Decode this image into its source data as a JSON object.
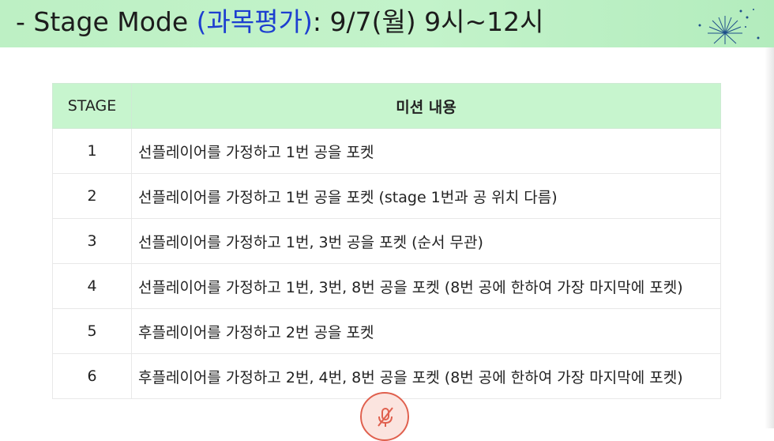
{
  "slide": {
    "title_prefix": "- Stage Mode ",
    "title_accent": "(과목평가)",
    "title_suffix": ": 9/7(월) 9시~12시"
  },
  "colors": {
    "header_band": "#c3f3ca",
    "title_accent": "#1d3fd0",
    "table_header": "#c7f5ce",
    "record_button": "#e0604e"
  },
  "table": {
    "headers": [
      "STAGE",
      "미션 내용"
    ],
    "rows": [
      {
        "stage": "1",
        "mission": "선플레이어를 가정하고 1번 공을 포켓"
      },
      {
        "stage": "2",
        "mission": "선플레이어를 가정하고 1번 공을 포켓 (stage 1번과 공 위치 다름)"
      },
      {
        "stage": "3",
        "mission": "선플레이어를 가정하고 1번, 3번 공을 포켓 (순서 무관)"
      },
      {
        "stage": "4",
        "mission": "선플레이어를 가정하고 1번, 3번, 8번 공을 포켓 (8번 공에 한하여 가장 마지막에 포켓)"
      },
      {
        "stage": "5",
        "mission": "후플레이어를 가정하고 2번 공을 포켓"
      },
      {
        "stage": "6",
        "mission": "후플레이어를 가정하고 2번, 4번, 8번 공을 포켓 (8번 공에 한하여 가장 마지막에 포켓)"
      }
    ]
  },
  "icons": {
    "decoration": "sparkle-icon",
    "mic_button": "mic-muted-icon"
  }
}
